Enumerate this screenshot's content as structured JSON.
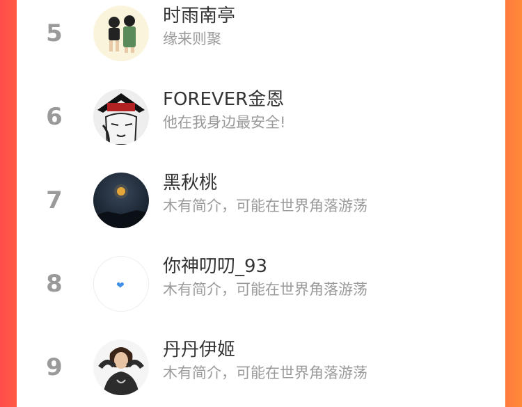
{
  "rows": [
    {
      "rank": "5",
      "name": "时雨南亭",
      "bio": "缘来则聚"
    },
    {
      "rank": "6",
      "name": "FOREVER金恩",
      "bio": "他在我身边最安全!"
    },
    {
      "rank": "7",
      "name": "黑秋桃",
      "bio": "木有简介，可能在世界角落游荡"
    },
    {
      "rank": "8",
      "name": "你神叨叨_93",
      "bio": "木有简介，可能在世界角落游荡",
      "avatar_icon": "blue-heart"
    },
    {
      "rank": "9",
      "name": "丹丹伊姬",
      "bio": "木有简介，可能在世界角落游荡"
    }
  ],
  "colors": {
    "left_edge": "#ff4d4a",
    "right_edge": "#ff7a3d",
    "rank_text": "#9a9a9a",
    "name_text": "#333333",
    "bio_text": "#9a9a9a"
  }
}
